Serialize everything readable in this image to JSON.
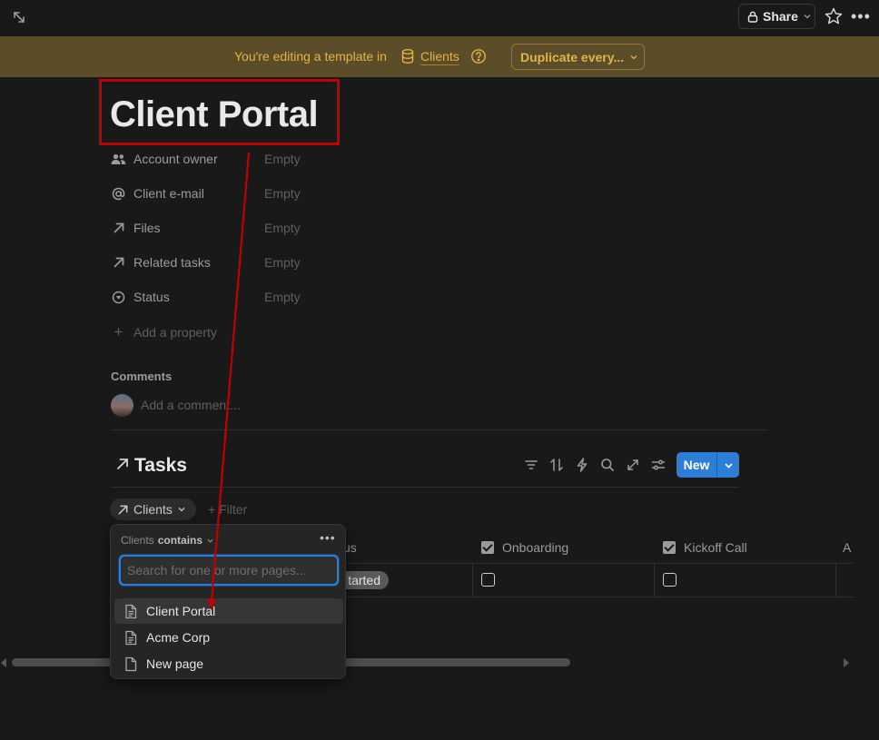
{
  "topbar": {
    "share_label": "Share",
    "icons": [
      "expand-icon",
      "lock-icon",
      "chevron-down-icon",
      "star-icon",
      "more-icon"
    ]
  },
  "banner": {
    "text": "You're editing a template in",
    "database_name": "Clients",
    "duplicate_label": "Duplicate every..."
  },
  "page": {
    "title": "Client Portal"
  },
  "properties": [
    {
      "name": "Account owner",
      "value": "Empty",
      "icon": "people-icon"
    },
    {
      "name": "Client e-mail",
      "value": "Empty",
      "icon": "at-icon"
    },
    {
      "name": "Files",
      "value": "Empty",
      "icon": "relation-arrow-icon"
    },
    {
      "name": "Related tasks",
      "value": "Empty",
      "icon": "relation-arrow-icon"
    },
    {
      "name": "Status",
      "value": "Empty",
      "icon": "status-icon"
    }
  ],
  "add_property_label": "Add a property",
  "comments": {
    "label": "Comments",
    "placeholder": "Add a comment..."
  },
  "tasks": {
    "title": "Tasks",
    "new_label": "New",
    "filter_chip_label": "Clients",
    "add_filter_label": "Filter",
    "columns": [
      {
        "label": "Onboarding"
      },
      {
        "label": "Kickoff Call"
      }
    ],
    "header_fragment": "us",
    "status_fragment": "tarted",
    "truncated_column": "A"
  },
  "dropdown": {
    "property": "Clients",
    "operator": "contains",
    "search_placeholder": "Search for one or more pages...",
    "items": [
      {
        "label": "Client Portal",
        "highlighted": true
      },
      {
        "label": "Acme Corp",
        "highlighted": false
      },
      {
        "label": "New page",
        "highlighted": false
      }
    ]
  },
  "colors": {
    "background": "#191919",
    "banner": "#5b4d27",
    "banner_text": "#e4b24b",
    "accent": "#2d7ed6",
    "annotation": "#c00000"
  }
}
